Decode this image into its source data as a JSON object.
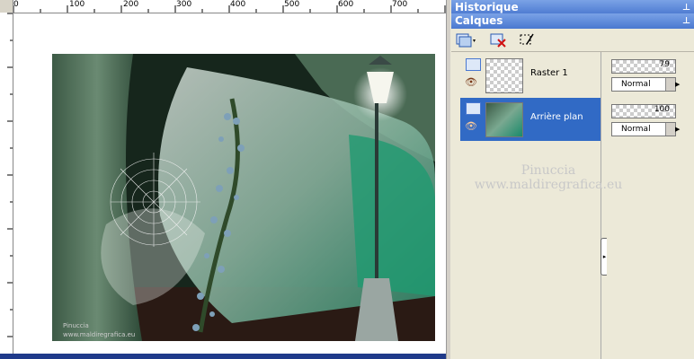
{
  "ruler": {
    "ticks": [
      "0",
      "100",
      "200",
      "300",
      "400",
      "500",
      "600",
      "700"
    ]
  },
  "panels": {
    "history_title": "Historique",
    "layers_title": "Calques",
    "pin_icon": "pin-icon"
  },
  "layers": [
    {
      "name": "Raster 1",
      "opacity": "79",
      "blend_mode": "Normal",
      "selected": false
    },
    {
      "name": "Arrière plan",
      "opacity": "100",
      "blend_mode": "Normal",
      "selected": true
    }
  ],
  "watermark": {
    "line1": "Pinuccia",
    "line2": "www.maldiregrafica.eu"
  },
  "art_signature": {
    "line1": "Pinuccia",
    "line2": "www.maldiregrafica.eu"
  },
  "colors": {
    "selection": "#316ac5",
    "panel_header": "#4a78d0"
  }
}
